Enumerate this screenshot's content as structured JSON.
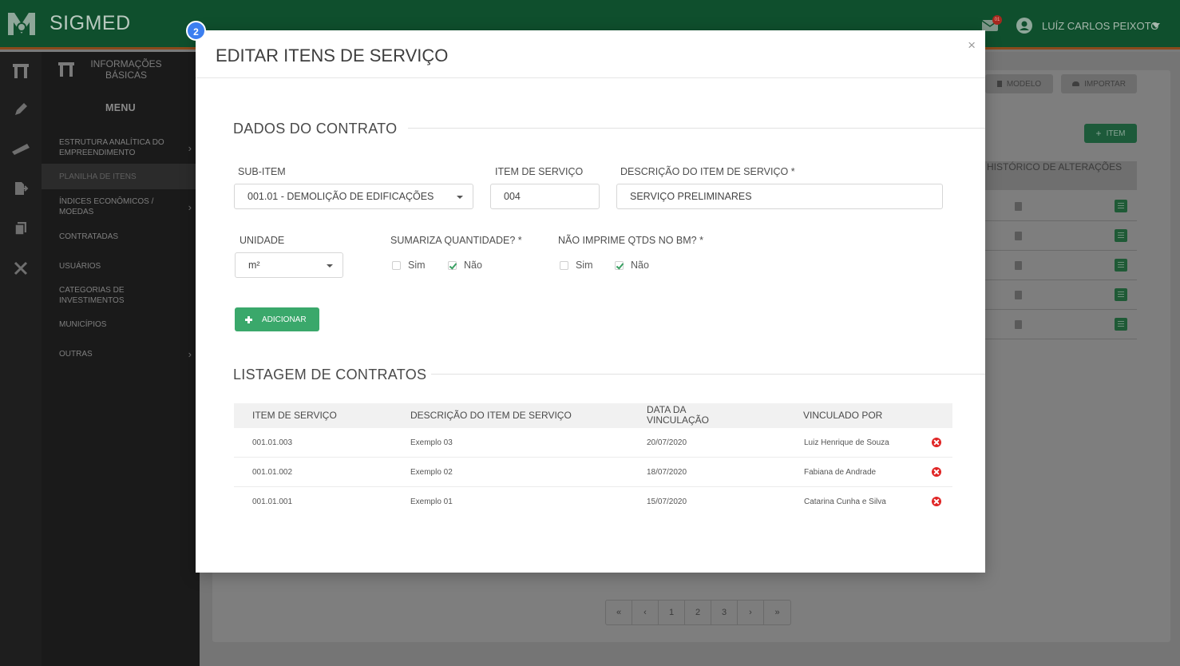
{
  "app": {
    "brand": "SIGMED",
    "mail_badge": "01",
    "user_name": "LUÍZ CARLOS PEIXOTO"
  },
  "sidebar": {
    "head_label": "INFORMAÇÕES BÁSICAS",
    "menu_title": "MENU",
    "items": [
      {
        "label": "ESTRUTURA ANALÍTICA DO EMPREENDIMENTO",
        "chevron": true
      },
      {
        "label": "PLANILHA DE ITENS",
        "active": true
      },
      {
        "label": "ÍNDICES ECONÔMICOS / MOEDAS",
        "chevron": true
      },
      {
        "label": "CONTRATADAS"
      },
      {
        "label": "USUÁRIOS"
      },
      {
        "label": "CATEGORIAS DE INVESTIMENTOS"
      },
      {
        "label": "MUNICÍPIOS"
      },
      {
        "label": "OUTRAS",
        "chevron": true
      }
    ]
  },
  "background": {
    "modelo_label": "MODELO",
    "importar_label": "IMPORTAR",
    "item_label": "ITEM",
    "historico_header": "HISTÓRICO DE ALTERAÇÕES",
    "pager": [
      "«",
      "‹",
      "1",
      "2",
      "3",
      "›",
      "»"
    ]
  },
  "modal": {
    "step": "2",
    "title": "EDITAR ITENS DE SERVIÇO",
    "close": "×",
    "section_dados": "DADOS DO CONTRATO",
    "subitem_label": "SUB-ITEM",
    "subitem_value": "001.01 - DEMOLIÇÃO DE EDIFICAÇÕES",
    "item_label": "ITEM DE SERVIÇO",
    "item_value": "004",
    "descricao_label": "DESCRIÇÃO DO ITEM DE SERVIÇO *",
    "descricao_value": "SERVIÇO PRELIMINARES",
    "unidade_label": "UNIDADE",
    "unidade_value": "m²",
    "sumariza_label": "SUMARIZA QUANTIDADE? *",
    "nao_imprime_label": "NÃO IMPRIME QTDS NO BM? *",
    "sim": "Sim",
    "nao": "Não",
    "add_button": "ADICIONAR",
    "section_listagem": "LISTAGEM DE CONTRATOS",
    "table": {
      "headers": [
        "ITEM DE SERVIÇO",
        "DESCRIÇÃO DO ITEM DE SERVIÇO",
        "DATA DA VINCULAÇÃO",
        "VINCULADO POR"
      ],
      "rows": [
        {
          "item": "001.01.003",
          "descricao": "Exemplo 03",
          "data": "20/07/2020",
          "vinculado": "Luiz Henrique de Souza"
        },
        {
          "item": "001.01.002",
          "descricao": "Exemplo 02",
          "data": "18/07/2020",
          "vinculado": "Fabiana de Andrade"
        },
        {
          "item": "001.01.001",
          "descricao": "Exemplo 01",
          "data": "15/07/2020",
          "vinculado": "Catarina Cunha e Silva"
        }
      ]
    }
  }
}
